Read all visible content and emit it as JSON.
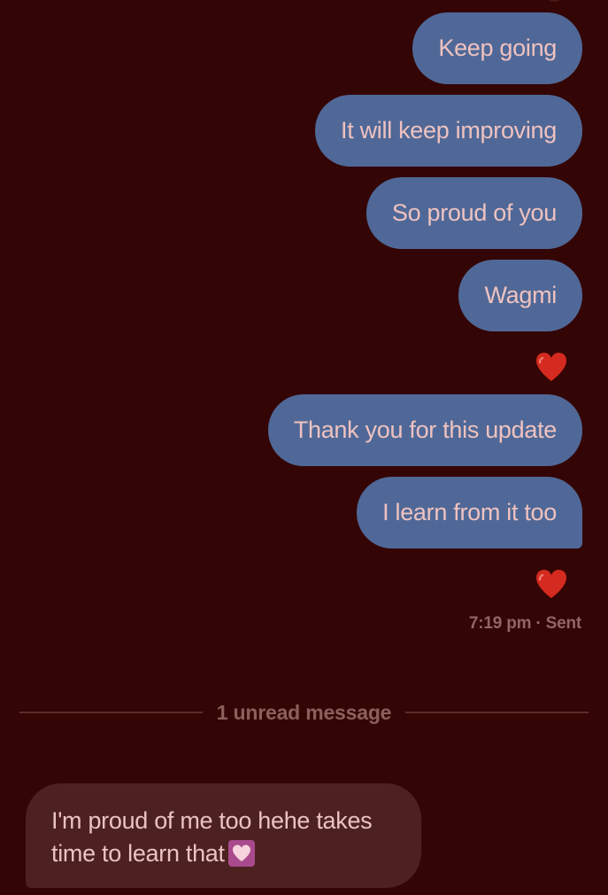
{
  "thread": {
    "sent_messages": [
      "Keep going",
      "It will keep improving",
      "So proud of you",
      "Wagmi",
      "Thank you for this update",
      "I learn from it too"
    ],
    "reaction_icon": "red-heart",
    "status": "7:19 pm · Sent",
    "unread_divider": "1 unread message",
    "received_message": "I'm proud of me too hehe takes time to learn that",
    "received_emoji": "pink-heart",
    "colors": {
      "background": "#340505",
      "sent_bubble": "#4f6897",
      "received_bubble": "#4d2120",
      "text": "#efc2c0",
      "reaction": "#d42a1f"
    }
  }
}
